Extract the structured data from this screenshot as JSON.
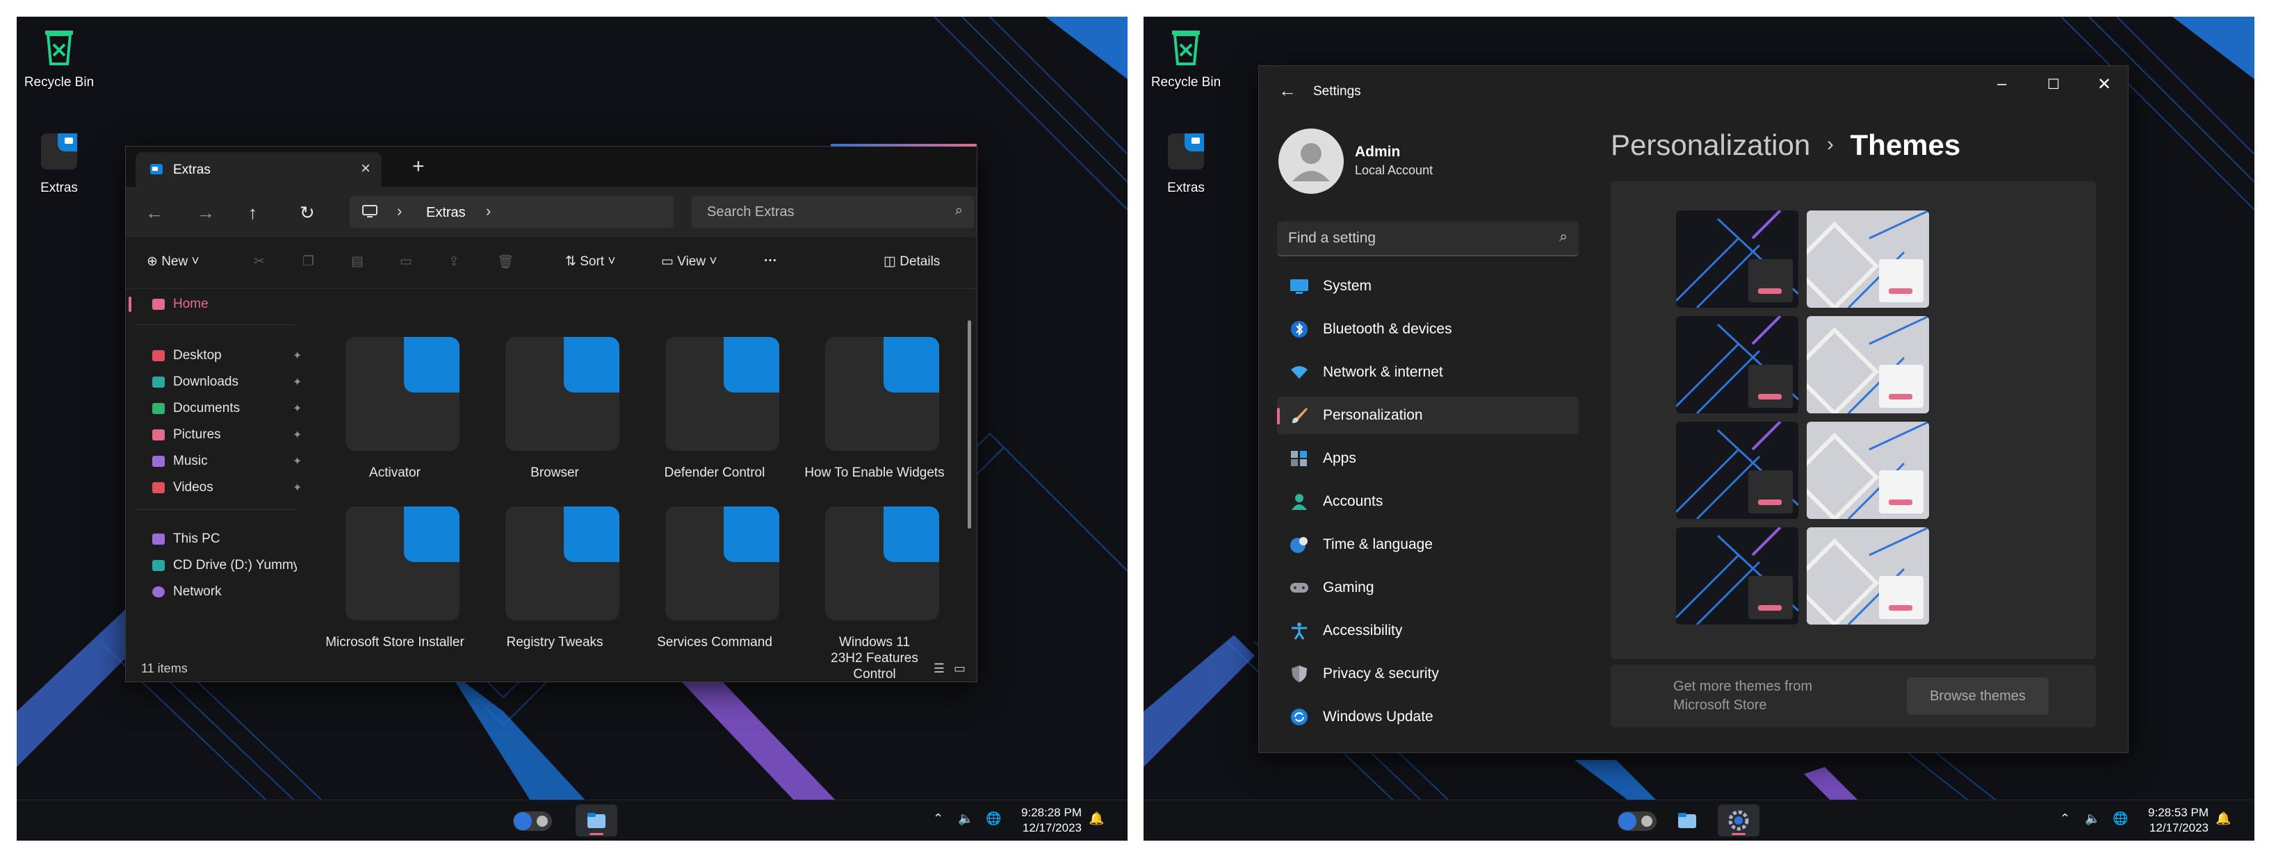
{
  "left": {
    "desktop_icons": [
      {
        "label": "Recycle Bin"
      },
      {
        "label": "Extras"
      }
    ],
    "explorer": {
      "tab_title": "Extras",
      "new_tab": "+",
      "address_segment": "Extras",
      "search_placeholder": "Search Extras",
      "toolbar": {
        "new": "New",
        "sort": "Sort",
        "view": "View",
        "details": "Details",
        "more": "···"
      },
      "sidebar": {
        "home": "Home",
        "pinned": [
          "Desktop",
          "Downloads",
          "Documents",
          "Pictures",
          "Music",
          "Videos"
        ],
        "this_pc": "This PC",
        "cd_drive": "CD Drive (D:) Yummy",
        "network": "Network"
      },
      "folders": [
        {
          "name": "Activator"
        },
        {
          "name": "Browser"
        },
        {
          "name": "Defender Control"
        },
        {
          "name": "How To Enable Widgets"
        },
        {
          "name": "Microsoft Store Installer"
        },
        {
          "name": "Registry Tweaks"
        },
        {
          "name": "Services Command"
        },
        {
          "name": "Windows 11 23H2 Features Control"
        }
      ],
      "status": "11 items"
    },
    "clock": {
      "time": "9:28:28 PM",
      "date": "12/17/2023"
    }
  },
  "right": {
    "desktop_icons": [
      {
        "label": "Recycle Bin"
      },
      {
        "label": "Extras"
      }
    ],
    "settings": {
      "window_title": "Settings",
      "user_name": "Admin",
      "user_type": "Local Account",
      "search_placeholder": "Find a setting",
      "nav": [
        {
          "label": "System",
          "icon": "monitor-icon"
        },
        {
          "label": "Bluetooth & devices",
          "icon": "bluetooth-icon"
        },
        {
          "label": "Network & internet",
          "icon": "wifi-icon"
        },
        {
          "label": "Personalization",
          "icon": "brush-icon",
          "selected": true
        },
        {
          "label": "Apps",
          "icon": "apps-icon"
        },
        {
          "label": "Accounts",
          "icon": "person-icon"
        },
        {
          "label": "Time & language",
          "icon": "globe-clock-icon"
        },
        {
          "label": "Gaming",
          "icon": "gamepad-icon"
        },
        {
          "label": "Accessibility",
          "icon": "accessibility-icon"
        },
        {
          "label": "Privacy & security",
          "icon": "shield-icon"
        },
        {
          "label": "Windows Update",
          "icon": "update-icon"
        }
      ],
      "breadcrumb_parent": "Personalization",
      "breadcrumb_sep": "›",
      "breadcrumb_current": "Themes",
      "more_themes_line1": "Get more themes from",
      "more_themes_line2": "Microsoft Store",
      "browse_button": "Browse themes"
    },
    "clock": {
      "time": "9:28:53 PM",
      "date": "12/17/2023"
    }
  },
  "colors": {
    "accent_blue": "#1183d8",
    "accent_pink": "#e66a8a",
    "window_bg": "#202020"
  }
}
